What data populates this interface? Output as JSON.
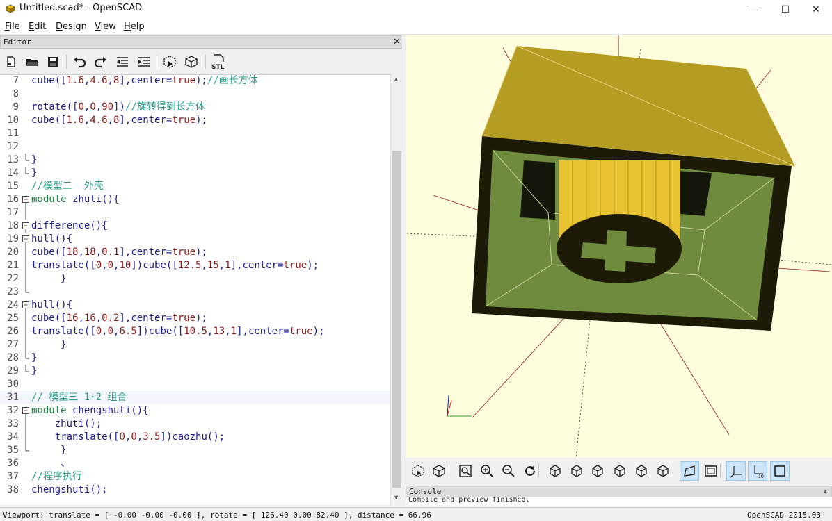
{
  "window": {
    "title": "Untitled.scad* - OpenSCAD",
    "minimize": "—",
    "maximize": "☐",
    "close": "✕"
  },
  "menu": [
    {
      "first": "F",
      "rest": "ile"
    },
    {
      "first": "E",
      "rest": "dit"
    },
    {
      "first": "D",
      "rest": "esign"
    },
    {
      "first": "V",
      "rest": "iew"
    },
    {
      "first": "H",
      "rest": "elp"
    }
  ],
  "editor": {
    "header": "Editor",
    "close": "✕",
    "toolbar": [
      "new-file-icon",
      "open-file-icon",
      "save-icon",
      "undo-icon",
      "redo-icon",
      "unindent-icon",
      "indent-icon",
      "preview-icon",
      "render-icon",
      "export-stl-icon"
    ],
    "stl_label": "STL",
    "lines": [
      {
        "n": "7",
        "fold": "",
        "segs": [
          [
            "bi",
            "cube"
          ],
          [
            "txt",
            "(["
          ],
          [
            "num",
            "1.6"
          ],
          [
            "txt",
            ","
          ],
          [
            "num",
            "4.6"
          ],
          [
            "txt",
            ","
          ],
          [
            "num",
            "8"
          ],
          [
            "txt",
            "],center="
          ],
          [
            "tk",
            "true"
          ],
          [
            "txt",
            ");"
          ],
          [
            "com",
            "//画长方体"
          ]
        ]
      },
      {
        "n": "8",
        "fold": "",
        "segs": []
      },
      {
        "n": "9",
        "fold": "",
        "segs": [
          [
            "bi",
            "rotate"
          ],
          [
            "txt",
            "(["
          ],
          [
            "num",
            "0"
          ],
          [
            "txt",
            ","
          ],
          [
            "num",
            "0"
          ],
          [
            "txt",
            ","
          ],
          [
            "num",
            "90"
          ],
          [
            "txt",
            "])"
          ],
          [
            "com",
            "//旋转得到长方体"
          ]
        ]
      },
      {
        "n": "10",
        "fold": "",
        "segs": [
          [
            "bi",
            "cube"
          ],
          [
            "txt",
            "(["
          ],
          [
            "num",
            "1.6"
          ],
          [
            "txt",
            ","
          ],
          [
            "num",
            "4.6"
          ],
          [
            "txt",
            ","
          ],
          [
            "num",
            "8"
          ],
          [
            "txt",
            "],center="
          ],
          [
            "tk",
            "true"
          ],
          [
            "txt",
            ");"
          ]
        ]
      },
      {
        "n": "11",
        "fold": "",
        "segs": []
      },
      {
        "n": "12",
        "fold": "",
        "segs": []
      },
      {
        "n": "13",
        "fold": "end",
        "segs": [
          [
            "txt",
            "}"
          ]
        ]
      },
      {
        "n": "14",
        "fold": "end",
        "segs": [
          [
            "txt",
            "}"
          ]
        ]
      },
      {
        "n": "15",
        "fold": "",
        "segs": [
          [
            "com",
            "//模型二  外壳"
          ]
        ]
      },
      {
        "n": "16",
        "fold": "start",
        "segs": [
          [
            "kw",
            "module"
          ],
          [
            "txt",
            " zhuti(){"
          ]
        ]
      },
      {
        "n": "17",
        "fold": "line",
        "segs": []
      },
      {
        "n": "18",
        "fold": "start",
        "segs": [
          [
            "bi",
            "difference"
          ],
          [
            "txt",
            "(){"
          ]
        ]
      },
      {
        "n": "19",
        "fold": "start",
        "segs": [
          [
            "bi",
            "hull"
          ],
          [
            "txt",
            "(){"
          ]
        ]
      },
      {
        "n": "20",
        "fold": "line",
        "segs": [
          [
            "bi",
            "cube"
          ],
          [
            "txt",
            "(["
          ],
          [
            "num",
            "18"
          ],
          [
            "txt",
            ","
          ],
          [
            "num",
            "18"
          ],
          [
            "txt",
            ","
          ],
          [
            "num",
            "0.1"
          ],
          [
            "txt",
            "],center="
          ],
          [
            "tk",
            "true"
          ],
          [
            "txt",
            ");"
          ]
        ]
      },
      {
        "n": "21",
        "fold": "line",
        "segs": [
          [
            "bi",
            "translate"
          ],
          [
            "txt",
            "(["
          ],
          [
            "num",
            "0"
          ],
          [
            "txt",
            ","
          ],
          [
            "num",
            "0"
          ],
          [
            "txt",
            ","
          ],
          [
            "num",
            "10"
          ],
          [
            "txt",
            "])"
          ],
          [
            "bi",
            "cube"
          ],
          [
            "txt",
            "(["
          ],
          [
            "num",
            "12.5"
          ],
          [
            "txt",
            ","
          ],
          [
            "num",
            "15"
          ],
          [
            "txt",
            ","
          ],
          [
            "num",
            "1"
          ],
          [
            "txt",
            "],center="
          ],
          [
            "tk",
            "true"
          ],
          [
            "txt",
            ");"
          ]
        ]
      },
      {
        "n": "22",
        "fold": "line",
        "segs": [
          [
            "txt",
            "     }"
          ]
        ]
      },
      {
        "n": "23",
        "fold": "end",
        "segs": []
      },
      {
        "n": "24",
        "fold": "start",
        "segs": [
          [
            "bi",
            "hull"
          ],
          [
            "txt",
            "(){"
          ]
        ]
      },
      {
        "n": "25",
        "fold": "line",
        "segs": [
          [
            "bi",
            "cube"
          ],
          [
            "txt",
            "(["
          ],
          [
            "num",
            "16"
          ],
          [
            "txt",
            ","
          ],
          [
            "num",
            "16"
          ],
          [
            "txt",
            ","
          ],
          [
            "num",
            "0.2"
          ],
          [
            "txt",
            "],center="
          ],
          [
            "tk",
            "true"
          ],
          [
            "txt",
            ");"
          ]
        ]
      },
      {
        "n": "26",
        "fold": "line",
        "segs": [
          [
            "bi",
            "translate"
          ],
          [
            "txt",
            "(["
          ],
          [
            "num",
            "0"
          ],
          [
            "txt",
            ","
          ],
          [
            "num",
            "0"
          ],
          [
            "txt",
            ","
          ],
          [
            "num",
            "6.5"
          ],
          [
            "txt",
            "])"
          ],
          [
            "bi",
            "cube"
          ],
          [
            "txt",
            "(["
          ],
          [
            "num",
            "10.5"
          ],
          [
            "txt",
            ","
          ],
          [
            "num",
            "13"
          ],
          [
            "txt",
            ","
          ],
          [
            "num",
            "1"
          ],
          [
            "txt",
            "],center="
          ],
          [
            "tk",
            "true"
          ],
          [
            "txt",
            ");"
          ]
        ]
      },
      {
        "n": "27",
        "fold": "line",
        "segs": [
          [
            "txt",
            "     }"
          ]
        ]
      },
      {
        "n": "28",
        "fold": "end",
        "segs": [
          [
            "txt",
            "}"
          ]
        ]
      },
      {
        "n": "29",
        "fold": "end",
        "segs": [
          [
            "txt",
            "}"
          ]
        ]
      },
      {
        "n": "30",
        "fold": "",
        "segs": []
      },
      {
        "n": "31",
        "fold": "",
        "current": true,
        "segs": [
          [
            "com",
            "// 模型三 1+2 组合"
          ]
        ]
      },
      {
        "n": "32",
        "fold": "start",
        "segs": [
          [
            "kw",
            "module"
          ],
          [
            "txt",
            " chengshuti(){"
          ]
        ]
      },
      {
        "n": "33",
        "fold": "line",
        "segs": [
          [
            "txt",
            "    zhuti();"
          ]
        ]
      },
      {
        "n": "34",
        "fold": "line",
        "segs": [
          [
            "txt",
            "    "
          ],
          [
            "bi",
            "translate"
          ],
          [
            "txt",
            "(["
          ],
          [
            "num",
            "0"
          ],
          [
            "txt",
            ","
          ],
          [
            "num",
            "0"
          ],
          [
            "txt",
            ","
          ],
          [
            "num",
            "3.5"
          ],
          [
            "txt",
            "])caozhu();"
          ]
        ]
      },
      {
        "n": "35",
        "fold": "end",
        "segs": [
          [
            "txt",
            "     }"
          ]
        ]
      },
      {
        "n": "36",
        "fold": "",
        "segs": [
          [
            "txt",
            "     、"
          ]
        ]
      },
      {
        "n": "37",
        "fold": "",
        "segs": [
          [
            "com",
            "//程序执行"
          ]
        ]
      },
      {
        "n": "38",
        "fold": "",
        "segs": [
          [
            "txt",
            "chengshuti();"
          ]
        ]
      }
    ]
  },
  "view_toolbar": [
    "preview-icon",
    "render-icon",
    "view-all-icon",
    "zoom-in-icon",
    "zoom-out-icon",
    "reset-view-icon",
    "view-right-icon",
    "view-top-icon",
    "view-bottom-icon",
    "view-left-icon",
    "view-front-icon",
    "view-back-icon",
    "perspective-icon",
    "orthogonal-icon",
    "show-axes-icon",
    "show-scale-markers-icon",
    "show-edges-icon"
  ],
  "console": {
    "header": "Console",
    "message": "Compile and preview finished."
  },
  "status": {
    "viewport": "Viewport: translate = [ -0.00 -0.00 -0.00 ], rotate = [ 126.40 0.00 82.40 ], distance = 66.96",
    "version": "OpenSCAD 2015.03"
  },
  "colors": {
    "viewport_bg": "#fefdde",
    "top_face": "#b59d24",
    "frame": "#1d1a08",
    "inner_green": "#6f8c3e",
    "cylinder": "#e8c230"
  }
}
